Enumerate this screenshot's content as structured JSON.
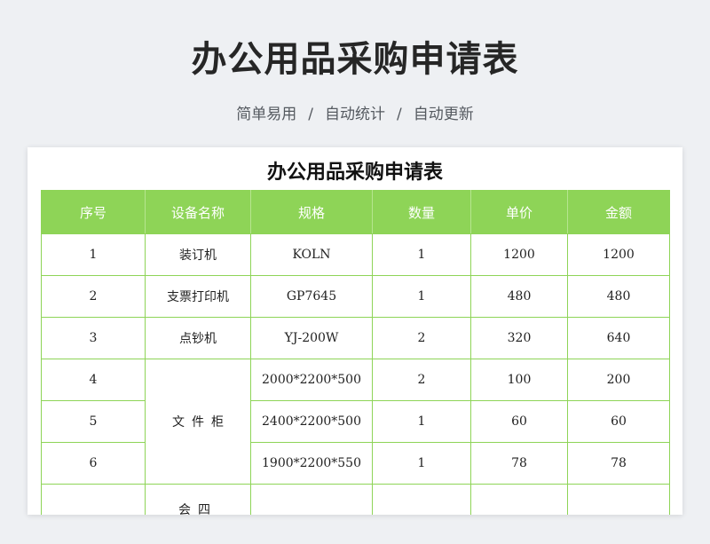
{
  "header": {
    "title": "办公用品采购申请表",
    "tags": [
      "简单易用",
      "自动统计",
      "自动更新"
    ],
    "separator": "/"
  },
  "sheet": {
    "title": "办公用品采购申请表",
    "columns": [
      "序号",
      "设备名称",
      "规格",
      "数量",
      "单价",
      "金额"
    ],
    "rows": [
      {
        "no": "1",
        "name": "装订机",
        "spec": "KOLN",
        "qty": "1",
        "price": "1200",
        "amount": "1200"
      },
      {
        "no": "2",
        "name": "支票打印机",
        "spec": "GP7645",
        "qty": "1",
        "price": "480",
        "amount": "480"
      },
      {
        "no": "3",
        "name": "点钞机",
        "spec": "YJ-200W",
        "qty": "2",
        "price": "320",
        "amount": "640"
      },
      {
        "no": "4",
        "name": "文件柜",
        "spec": "2000*2200*500",
        "qty": "2",
        "price": "100",
        "amount": "200"
      },
      {
        "no": "5",
        "name": "",
        "spec": "2400*2200*500",
        "qty": "1",
        "price": "60",
        "amount": "60"
      },
      {
        "no": "6",
        "name": "",
        "spec": "1900*2200*550",
        "qty": "1",
        "price": "78",
        "amount": "78"
      },
      {
        "no": "",
        "name": "",
        "spec": "",
        "qty": "",
        "price": "",
        "amount": ""
      }
    ],
    "merged_name_label": "文件柜",
    "clipped_row_name_fragment": "会四"
  },
  "colors": {
    "header_green": "#8ed457",
    "border_green": "#8ed457",
    "background": "#eef0f3"
  }
}
